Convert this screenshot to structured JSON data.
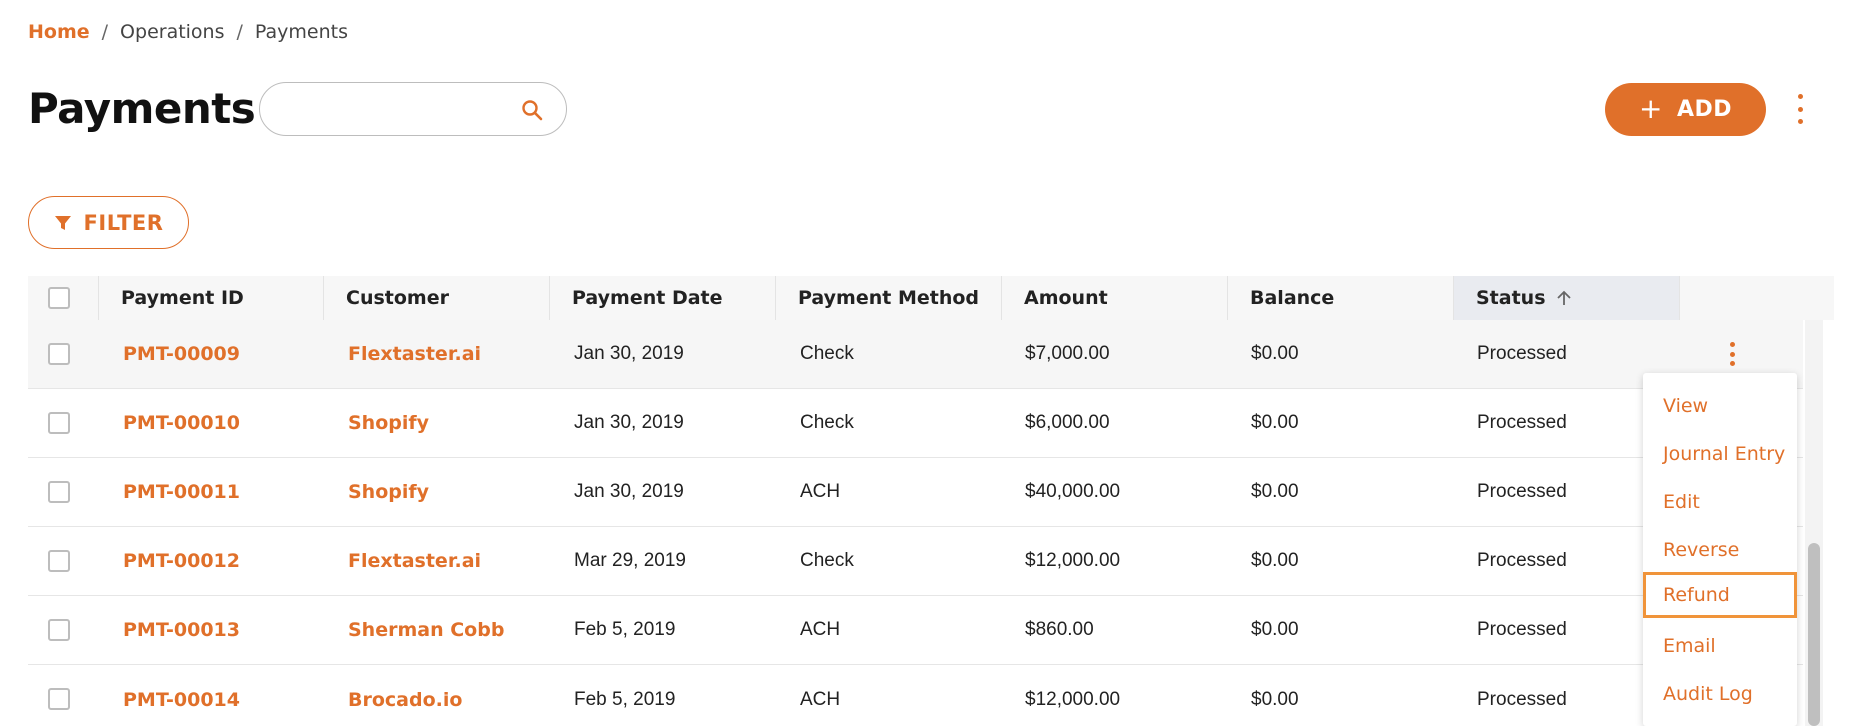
{
  "breadcrumb": {
    "home": "Home",
    "items": [
      "Operations",
      "Payments"
    ],
    "separator": "/"
  },
  "page": {
    "title": "Payments"
  },
  "search": {
    "value": "",
    "placeholder": ""
  },
  "toolbar": {
    "add_label": "ADD",
    "add_icon": "+",
    "filter_label": "FILTER"
  },
  "table": {
    "columns": [
      "Payment ID",
      "Customer",
      "Payment Date",
      "Payment Method",
      "Amount",
      "Balance",
      "Status"
    ],
    "sorted_column": "Status",
    "sort_direction": "ascending",
    "rows": [
      {
        "id": "PMT-00009",
        "customer": "Flextaster.ai",
        "date": "Jan 30, 2019",
        "method": "Check",
        "amount": "$7,000.00",
        "balance": "$0.00",
        "status": "Processed"
      },
      {
        "id": "PMT-00010",
        "customer": "Shopify",
        "date": "Jan 30, 2019",
        "method": "Check",
        "amount": "$6,000.00",
        "balance": "$0.00",
        "status": "Processed"
      },
      {
        "id": "PMT-00011",
        "customer": "Shopify",
        "date": "Jan 30, 2019",
        "method": "ACH",
        "amount": "$40,000.00",
        "balance": "$0.00",
        "status": "Processed"
      },
      {
        "id": "PMT-00012",
        "customer": "Flextaster.ai",
        "date": "Mar 29, 2019",
        "method": "Check",
        "amount": "$12,000.00",
        "balance": "$0.00",
        "status": "Processed"
      },
      {
        "id": "PMT-00013",
        "customer": "Sherman Cobb",
        "date": "Feb 5, 2019",
        "method": "ACH",
        "amount": "$860.00",
        "balance": "$0.00",
        "status": "Processed"
      },
      {
        "id": "PMT-00014",
        "customer": "Brocado.io",
        "date": "Feb 5, 2019",
        "method": "ACH",
        "amount": "$12,000.00",
        "balance": "$0.00",
        "status": "Processed"
      }
    ]
  },
  "row_menu": {
    "items": [
      "View",
      "Journal Entry",
      "Edit",
      "Reverse",
      "Refund",
      "Email",
      "Audit Log"
    ],
    "focused": "Refund"
  },
  "colors": {
    "accent": "#e0702a",
    "focus": "#f0943a",
    "header_bg": "#f7f7f7",
    "sorted_header_bg": "#e9ebf0"
  },
  "icons": {
    "search": "search-icon",
    "filter": "filter-icon",
    "kebab": "kebab-icon",
    "sort": "arrow-up-icon"
  }
}
